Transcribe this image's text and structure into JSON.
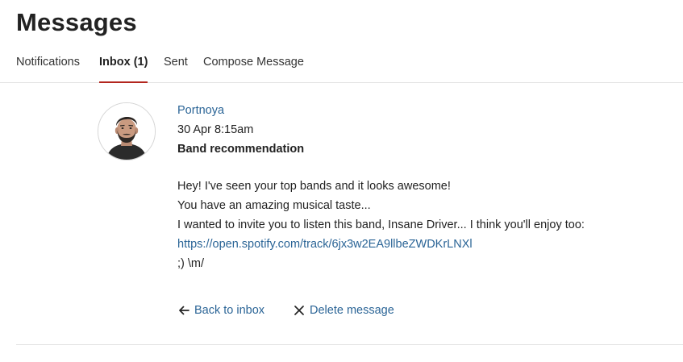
{
  "page": {
    "title": "Messages"
  },
  "tabs": [
    {
      "label": "Notifications",
      "active": false
    },
    {
      "label": "Inbox (1)",
      "active": true
    },
    {
      "label": "Sent",
      "active": false
    },
    {
      "label": "Compose Message",
      "active": false
    }
  ],
  "message": {
    "sender": "Portnoya",
    "timestamp": "30 Apr 8:15am",
    "subject": "Band recommendation",
    "body_lines": [
      "Hey! I've seen your top bands and it looks awesome!",
      "You have an amazing musical taste...",
      "I wanted to invite you to listen this band, Insane Driver... I think you'll enjoy too:",
      "https://open.spotify.com/track/6jx3w2EA9llbeZWDKrLNXl",
      ";) \\m/"
    ]
  },
  "actions": {
    "back_label": "Back to inbox",
    "back_icon": "arrow-left-icon",
    "delete_label": "Delete message",
    "delete_icon": "close-icon"
  },
  "colors": {
    "accent": "#b3261e",
    "link": "#2a6496",
    "text": "#222222"
  }
}
